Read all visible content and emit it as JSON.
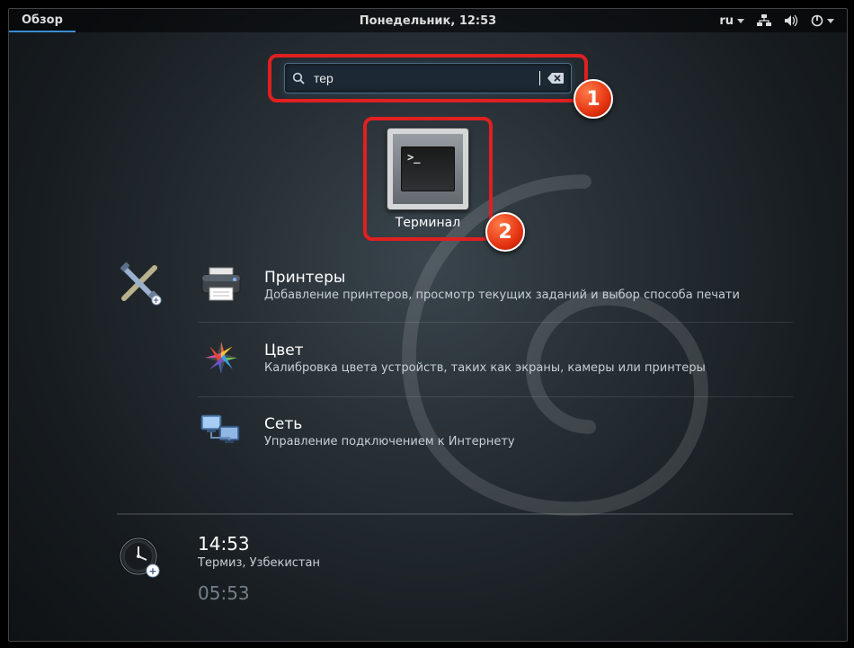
{
  "topbar": {
    "activities_label": "Обзор",
    "clock_text": "Понедельник, 12:53",
    "lang_label": "ru"
  },
  "search": {
    "query": "тер"
  },
  "app_result": {
    "label": "Терминал",
    "icon_name": "terminal-icon"
  },
  "callouts": {
    "one": "1",
    "two": "2"
  },
  "settings_results": [
    {
      "id": "printers",
      "title": "Принтеры",
      "desc": "Добавление принтеров, просмотр текущих заданий и выбор способа печати"
    },
    {
      "id": "color",
      "title": "Цвет",
      "desc": "Калибровка цвета устройств, таких как экраны, камеры или принтеры"
    },
    {
      "id": "network",
      "title": "Сеть",
      "desc": "Управление подключением к Интернету"
    }
  ],
  "clock_results": [
    {
      "time": "14:53",
      "location": "Термиз, Узбекистан",
      "dim": false
    },
    {
      "time": "05:53",
      "location": "",
      "dim": true
    }
  ]
}
